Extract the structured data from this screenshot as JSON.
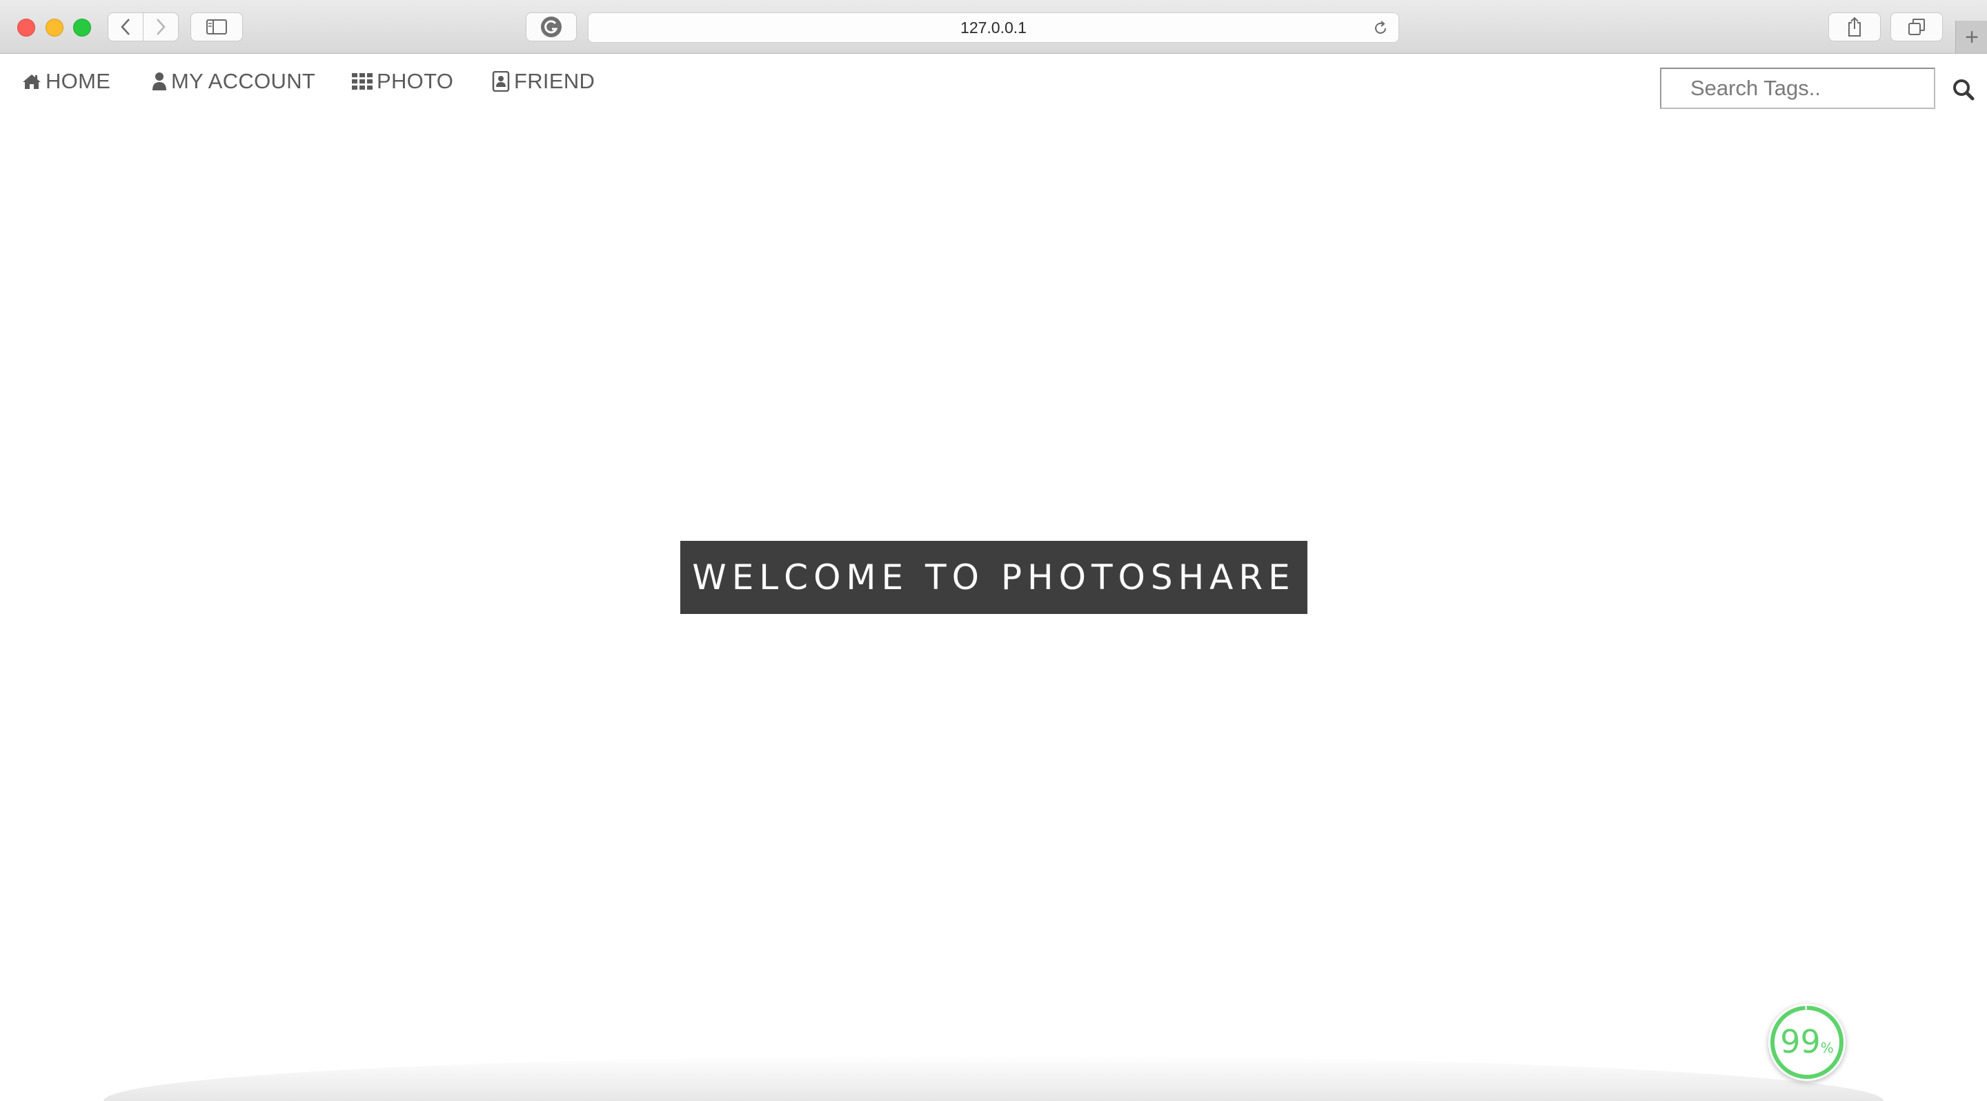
{
  "browser": {
    "url": "127.0.0.1",
    "new_tab_label": "+"
  },
  "nav": {
    "home": "HOME",
    "my_account": "MY ACCOUNT",
    "photo": "PHOTO",
    "friend": "FRIEND"
  },
  "search": {
    "placeholder": "Search Tags.."
  },
  "banner": {
    "title": "WELCOME TO PHOTOSHARE"
  },
  "progress_widget": {
    "value": "99",
    "unit": "%",
    "fraction": 0.99,
    "color": "#5ed36c"
  },
  "colors": {
    "banner_bg": "#3e3e3e",
    "nav_text": "#5a5a5a"
  }
}
